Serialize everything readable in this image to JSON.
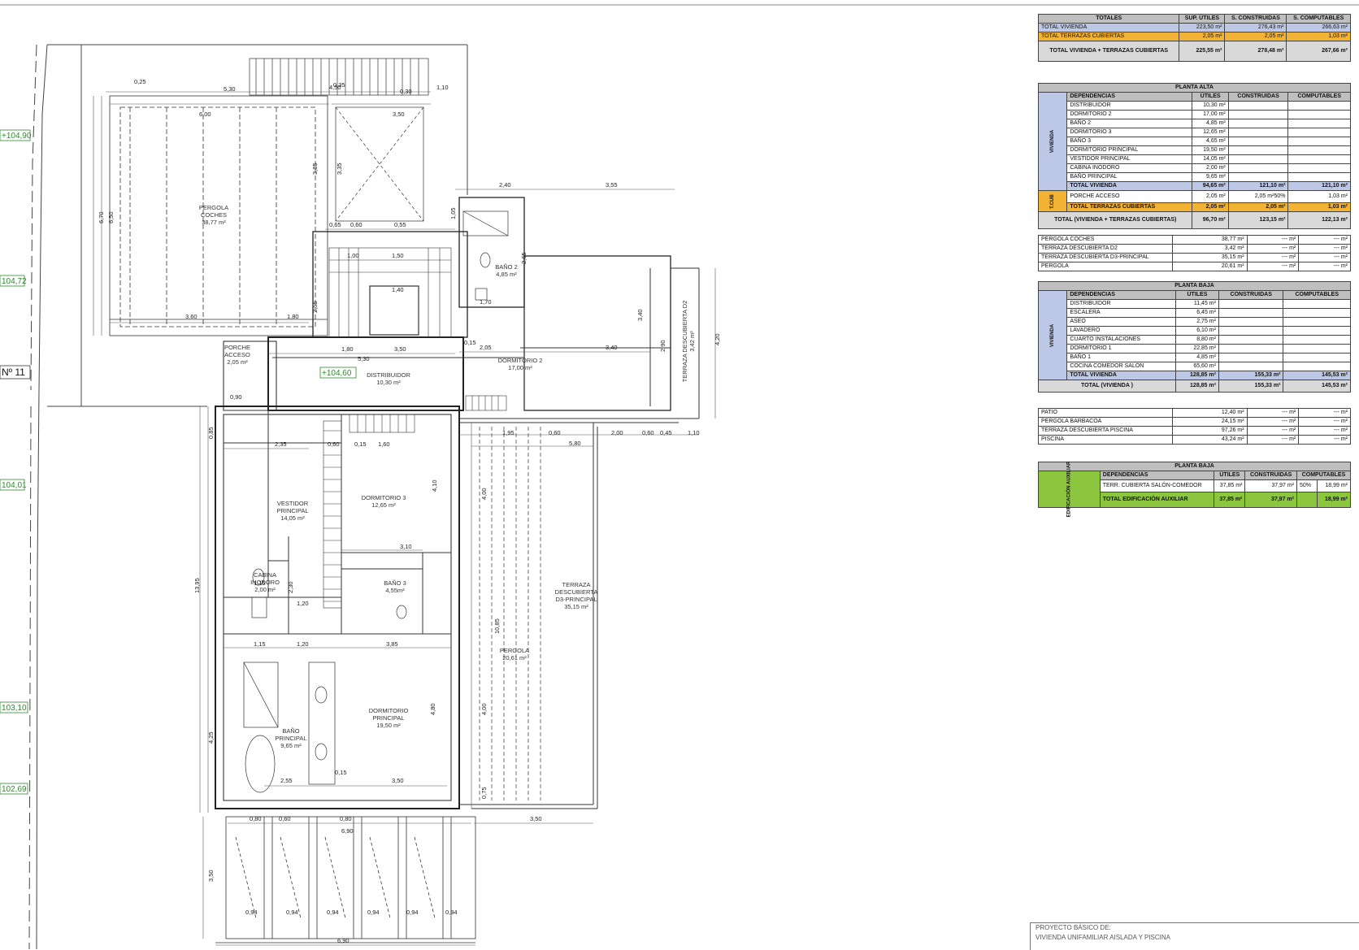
{
  "plan": {
    "levels": [
      "+104,90",
      "104,72",
      "104,01",
      "103,10",
      "102,69"
    ],
    "street_label": "Nº 11",
    "interior_level": "+104,60",
    "rooms": {
      "pergola_coches": [
        "PERGOLA",
        "COCHES",
        "38,77 m²"
      ],
      "porche": [
        "PORCHE",
        "ACCESO",
        "2,05 m²"
      ],
      "distribuidor": [
        "DISTRIBUIDOR",
        "10,30 m²"
      ],
      "bano2": [
        "BAÑO 2",
        "4,85 m²"
      ],
      "dormitorio2": [
        "DORMITORIO 2",
        "17,00 m²"
      ],
      "terraza_d2": [
        "TERRAZA DESCUBIERTA D2",
        "3,42 m²"
      ],
      "vestidor": [
        "VESTIDOR",
        "PRINCIPAL",
        "14,05 m²"
      ],
      "dormitorio3": [
        "DORMITORIO 3",
        "12,65 m²"
      ],
      "cabina": [
        "CABINA",
        "INODORO",
        "2,00 m²"
      ],
      "bano3": [
        "BAÑO 3",
        "4,55m²"
      ],
      "terraza_d3": [
        "TERRAZA",
        "DESCUBIERTA",
        "D3-PRINCIPAL",
        "35,15 m²"
      ],
      "pergola": [
        "PERGOLA",
        "20,61 m²"
      ],
      "dormitorio_principal": [
        "DORMITORIO",
        "PRINCIPAL",
        "19,50 m²"
      ],
      "bano_principal": [
        "BAÑO",
        "PRINCIPAL",
        "9,65 m²"
      ]
    },
    "dims": {
      "d450": "4,50",
      "d110": "1,10",
      "d025": "0,25",
      "d530": "5,30",
      "d035": "0,35",
      "d030": "0,30",
      "d600": "6,00",
      "d350a": "3,50",
      "d670": "6,70",
      "d650": "6,50",
      "d385": "3,85",
      "d335": "3,35",
      "d240": "2,40",
      "d355": "3,55",
      "d105": "1,05",
      "d065": "0,65",
      "d060": "0,60",
      "d055": "0,55",
      "d100": "1,00",
      "d150": "1,50",
      "d140": "1,40",
      "d255": "2,55",
      "d180": "1,80",
      "d360": "3,60",
      "d265": "2,65",
      "d170": "1,70",
      "d205": "2,05",
      "d340": "3,40",
      "d290": "2,90",
      "d420": "4,20",
      "d090": "0,90",
      "d015": "0,15",
      "d196": "1,95",
      "d200": "2,00",
      "d045": "0,45",
      "d580": "5,80",
      "d235": "2,35",
      "d160": "1,60",
      "d410": "4,10",
      "d310": "3,10",
      "d115": "1,15",
      "d120": "1,20",
      "d230": "2,30",
      "d1395": "13,95",
      "d1085": "10,85",
      "d425": "4,25",
      "d480": "4,80",
      "d255b": "2,55",
      "d075": "0,75",
      "d080": "0,80",
      "d094": "0,94",
      "d690": "6,90",
      "d085": "0,85",
      "d400": "4,00"
    }
  },
  "totales": {
    "headers": [
      "TOTALES",
      "SUP. ÚTILES",
      "S. CONSTRUIDAS",
      "S. COMPUTABLES"
    ],
    "rows": [
      {
        "label": "TOTAL VIVIENDA",
        "utiles": "223,50 m²",
        "construidas": "276,43 m²",
        "computables": "266,63 m²"
      },
      {
        "label": "TOTAL TERRAZAS CUBIERTAS",
        "utiles": "2,05 m²",
        "construidas": "2,05 m²",
        "computables": "1,03 m²"
      },
      {
        "label": "TOTAL VIVIENDA + TERRAZAS CUBIERTAS",
        "utiles": "225,55 m²",
        "construidas": "278,48 m²",
        "computables": "267,66 m²"
      }
    ]
  },
  "planta_alta": {
    "title": "PLANTA ALTA",
    "headers": [
      "DEPENDENCIAS",
      "ÚTILES",
      "CONSTRUIDAS",
      "COMPUTABLES"
    ],
    "side_vivienda": "VIVIENDA",
    "side_tcub": "T.CUB",
    "rows": [
      {
        "label": "DISTRIBUIDOR",
        "utiles": "10,30 m²"
      },
      {
        "label": "DORMITORIO 2",
        "utiles": "17,00 m²"
      },
      {
        "label": "BAÑO 2",
        "utiles": "4,85 m²"
      },
      {
        "label": "DORMITORIO 3",
        "utiles": "12,65 m²"
      },
      {
        "label": "BAÑO 3",
        "utiles": "4,65 m²"
      },
      {
        "label": "DORMITORIO PRINCIPAL",
        "utiles": "19,50 m²"
      },
      {
        "label": "VESTIDOR PRINCIPAL",
        "utiles": "14,05 m²"
      },
      {
        "label": "CABINA INODORO",
        "utiles": "2,00 m²"
      },
      {
        "label": "BAÑO PRINCIPAL",
        "utiles": "9,65 m²"
      }
    ],
    "total_vivienda": {
      "label": "TOTAL VIVIENDA",
      "utiles": "94,65 m²",
      "construidas": "121,10 m²",
      "computables": "121,10 m²"
    },
    "porche": {
      "label": "PORCHE ACCESO",
      "utiles": "2,05 m²",
      "construidas": "2,05 m²",
      "pct": "50%",
      "computables": "1,03 m²"
    },
    "total_terrazas": {
      "label": "TOTAL TERRAZAS CUBIERTAS",
      "utiles": "2,05 m²",
      "construidas": "2,05 m²",
      "computables": "1,03 m²"
    },
    "total_all": {
      "label": "TOTAL (VIVIENDA + TERRAZAS CUBIERTAS)",
      "utiles": "96,70 m²",
      "construidas": "123,15 m²",
      "computables": "122,13 m²"
    },
    "extra": [
      {
        "label": "PERGOLA COCHES",
        "utiles": "38,77 m²",
        "construidas": "--- m²",
        "computables": "--- m²"
      },
      {
        "label": "TERRAZA DESCUBIERTA D2",
        "utiles": "3,42 m²",
        "construidas": "--- m²",
        "computables": "--- m²"
      },
      {
        "label": "TERRAZA DESCUBIERTA D3-PRINCIPAL",
        "utiles": "35,15 m²",
        "construidas": "--- m²",
        "computables": "--- m²"
      },
      {
        "label": "PERGOLA",
        "utiles": "20,61 m²",
        "construidas": "--- m²",
        "computables": "--- m²"
      }
    ]
  },
  "planta_baja": {
    "title": "PLANTA BAJA",
    "headers": [
      "DEPENDENCIAS",
      "ÚTILES",
      "CONSTRUIDAS",
      "COMPUTABLES"
    ],
    "side_vivienda": "VIVIENDA",
    "rows": [
      {
        "label": "DISTRIBUIDOR",
        "utiles": "11,45 m²"
      },
      {
        "label": "ESCALERA",
        "utiles": "6,45 m²"
      },
      {
        "label": "ASEO",
        "utiles": "2,75 m²"
      },
      {
        "label": "LAVADERO",
        "utiles": "6,10 m²"
      },
      {
        "label": "CUARTO INSTALACIONES",
        "utiles": "8,80 m²"
      },
      {
        "label": "DORMITORIO 1",
        "utiles": "22,85 m²"
      },
      {
        "label": "BAÑO 1",
        "utiles": "4,85 m²"
      },
      {
        "label": "COCINA COMEDOR SALÓN",
        "utiles": "65,60 m²"
      }
    ],
    "total_vivienda": {
      "label": "TOTAL VIVIENDA",
      "utiles": "128,85 m²",
      "construidas": "155,33 m²",
      "computables": "145,53 m²"
    },
    "total_all": {
      "label": "TOTAL (VIVIENDA )",
      "utiles": "128,85 m²",
      "construidas": "155,33 m²",
      "computables": "145,53 m²"
    },
    "extra": [
      {
        "label": "PATIO",
        "utiles": "12,40 m²",
        "construidas": "--- m²",
        "computables": "--- m²"
      },
      {
        "label": "PERGOLA BARBACOA",
        "utiles": "24,15 m²",
        "construidas": "--- m²",
        "computables": "--- m²"
      },
      {
        "label": "TERRAZA DESCUBIERTA PISCINA",
        "utiles": "97,26 m²",
        "construidas": "--- m²",
        "computables": "--- m²"
      },
      {
        "label": "PISCINA",
        "utiles": "43,24 m²",
        "construidas": "--- m²",
        "computables": "--- m²"
      }
    ]
  },
  "auxiliar": {
    "title": "PLANTA BAJA",
    "side": "EDIFICACIÓN AUXILIAR",
    "headers": [
      "DEPENDENCIAS",
      "ÚTILES",
      "CONSTRUIDAS",
      "COMPUTABLES"
    ],
    "row": {
      "label": "TERR. CUBIERTA SALÓN-COMEDOR",
      "utiles": "37,85 m²",
      "construidas": "37,97 m²",
      "pct": "50%",
      "computables": "18,99 m²"
    },
    "total": {
      "label": "TOTAL EDIFICACIÓN AUXILIAR",
      "utiles": "37,85 m²",
      "construidas": "37,97 m²",
      "computables": "18,99 m²"
    }
  },
  "title_block": {
    "line1": "PROYECTO BÁSICO DE:",
    "line2": "VIVIENDA UNIFAMILIAR AISLADA Y PISCINA"
  }
}
